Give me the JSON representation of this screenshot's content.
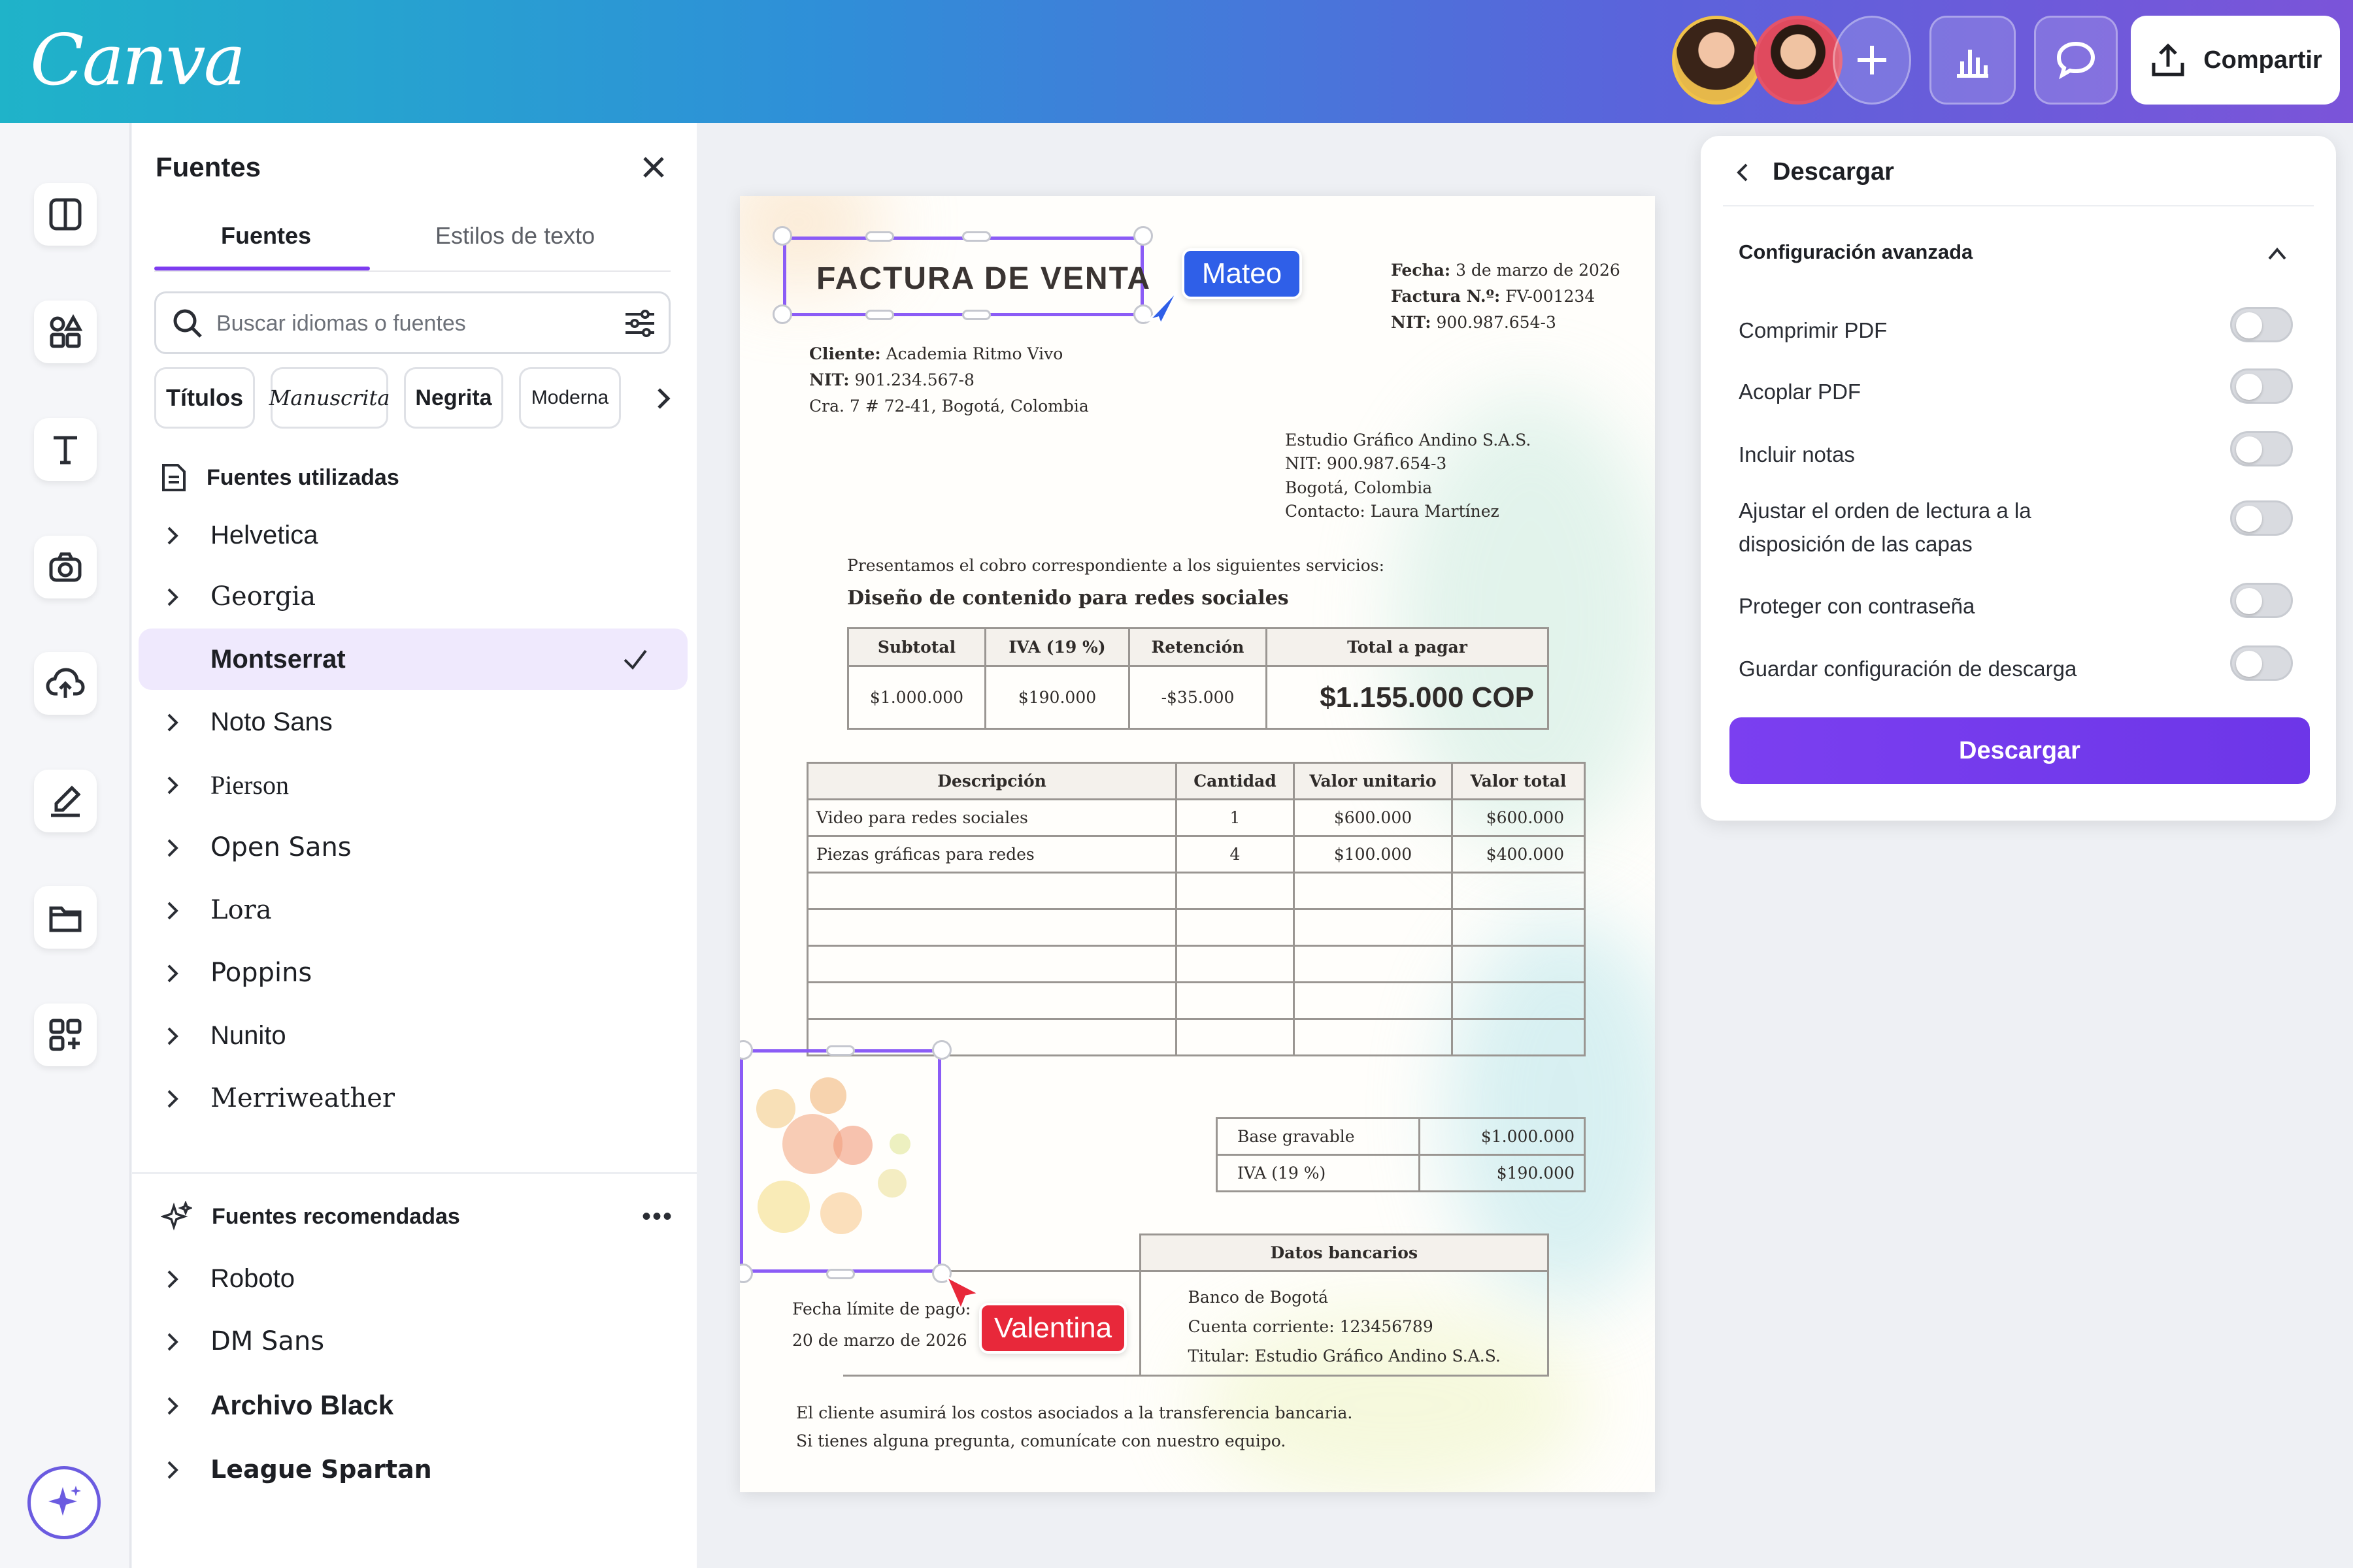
{
  "app": {
    "logo": "Canva"
  },
  "topbar": {
    "share_label": "Compartir"
  },
  "font_panel": {
    "title": "Fuentes",
    "tabs": [
      {
        "label": "Fuentes",
        "active": true
      },
      {
        "label": "Estilos de texto",
        "active": false
      }
    ],
    "search_placeholder": "Buscar idiomas o fuentes",
    "chips": [
      "Títulos",
      "Manuscrita",
      "Negrita",
      "Moderna"
    ],
    "used_heading": "Fuentes utilizadas",
    "used_fonts": [
      "Helvetica",
      "Georgia",
      "Montserrat",
      "Noto Sans",
      "Pierson",
      "Open Sans",
      "Lora",
      "Poppins",
      "Nunito",
      "Merriweather"
    ],
    "selected_font": "Montserrat",
    "recommended_heading": "Fuentes recomendadas",
    "recommended_fonts": [
      "Roboto",
      "DM Sans",
      "Archivo Black",
      "League Spartan"
    ]
  },
  "document": {
    "title": "FACTURA DE VENTA",
    "collaborator_1": "Mateo",
    "collaborator_2": "Valentina",
    "meta": {
      "fecha_label": "Fecha:",
      "fecha": "3 de marzo de 2026",
      "factura_label": "Factura N.º:",
      "factura": "FV-001234",
      "nit_label": "NIT:",
      "nit": "900.987.654-3"
    },
    "client": {
      "cliente_label": "Cliente:",
      "cliente": "Academia Ritmo Vivo",
      "nit_label": "NIT:",
      "nit": "901.234.567-8",
      "address": "Cra. 7 # 72-41, Bogotá, Colombia"
    },
    "issuer": {
      "name": "Estudio Gráfico Andino S.A.S.",
      "nit": "NIT: 900.987.654-3",
      "city": "Bogotá, Colombia",
      "contact": "Contacto: Laura Martínez"
    },
    "intro": "Presentamos el cobro correspondiente a los siguientes servicios:",
    "service_title": "Diseño de contenido para redes sociales",
    "summary": {
      "headers": [
        "Subtotal",
        "IVA (19 %)",
        "Retención",
        "Total a pagar"
      ],
      "values": [
        "$1.000.000",
        "$190.000",
        "-$35.000",
        "$1.155.000 COP"
      ]
    },
    "items": {
      "headers": [
        "Descripción",
        "Cantidad",
        "Valor unitario",
        "Valor total"
      ],
      "rows": [
        [
          "Video para redes sociales",
          "1",
          "$600.000",
          "$600.000"
        ],
        [
          "Piezas gráficas para redes",
          "4",
          "$100.000",
          "$400.000"
        ]
      ]
    },
    "totals": [
      [
        "Base gravable",
        "$1.000.000"
      ],
      [
        "IVA (19 %)",
        "$190.000"
      ]
    ],
    "due_label": "Fecha límite de pago:",
    "due_date": "20 de marzo de 2026",
    "bank": {
      "header": "Datos bancarios",
      "bank": "Banco de Bogotá",
      "account": "Cuenta corriente: 123456789",
      "holder": "Titular: Estudio Gráfico Andino S.A.S."
    },
    "footer_1": "El cliente asumirá los costos asociados a la transferencia bancaria.",
    "footer_2": "Si tienes alguna pregunta, comunícate con nuestro equipo."
  },
  "download_panel": {
    "title": "Descargar",
    "section": "Configuración avanzada",
    "options": [
      {
        "label": "Comprimir PDF",
        "on": false
      },
      {
        "label": "Acoplar PDF",
        "on": false
      },
      {
        "label": "Incluir notas",
        "on": false
      },
      {
        "label": "Ajustar el orden de lectura a la disposición de las capas",
        "label_line1": "Ajustar el orden de lectura a la",
        "label_line2": "disposición de las capas",
        "on": false
      },
      {
        "label": "Proteger con contraseña",
        "on": false
      },
      {
        "label": "Guardar configuración de descarga",
        "on": false
      }
    ],
    "button": "Descargar"
  },
  "colors": {
    "accent": "#7d3cf0",
    "mateo": "#2f5fe8",
    "valentina": "#e8283a"
  }
}
